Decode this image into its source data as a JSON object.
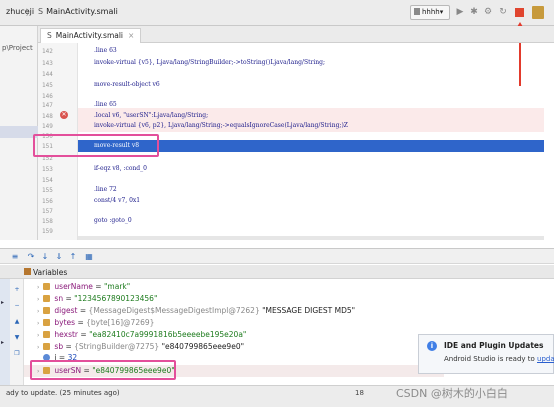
{
  "breadcrumb": {
    "project": "zhuceji",
    "separator": "〉",
    "file_prefix": "S",
    "file": "MainActivity.smali"
  },
  "toolbar": {
    "run_config": "hhhh",
    "run_config_arrow": "▾"
  },
  "project_panel": {
    "label": "p\\Project"
  },
  "editor": {
    "tab": {
      "prefix": "S",
      "label": "MainActivity.smali",
      "close": "×"
    },
    "lines": [
      {
        "num": "142",
        "code": ".line 63"
      },
      {
        "num": "143",
        "code": "invoke-virtual {v5}, Ljava/lang/StringBuilder;->toString()Ljava/lang/String;"
      },
      {
        "num": "144",
        "code": ""
      },
      {
        "num": "145",
        "code": "move-result-object v6"
      },
      {
        "num": "146",
        "code": ""
      },
      {
        "num": "147",
        "code": ".line 65"
      },
      {
        "num": "148",
        "code": ".local v6, \"userSN\":Ljava/lang/String;"
      },
      {
        "num": "149",
        "code": "invoke-virtual {v6, p2}, Ljava/lang/String;->equalsIgnoreCase(Ljava/lang/String;)Z"
      },
      {
        "num": "150",
        "code": ""
      },
      {
        "num": "151",
        "code": "move-result v8"
      },
      {
        "num": "152",
        "code": ""
      },
      {
        "num": "153",
        "code": "if-eqz v8, :cond_0"
      },
      {
        "num": "154",
        "code": ""
      },
      {
        "num": "155",
        "code": ".line 72"
      },
      {
        "num": "156",
        "code": "const/4 v7, 0x1"
      },
      {
        "num": "157",
        "code": ""
      },
      {
        "num": "158",
        "code": "goto :goto_0"
      },
      {
        "num": "159",
        "code": ""
      }
    ],
    "breakpoint_glyph": "✕"
  },
  "debug": {
    "panel_title": "Variables",
    "variables": [
      {
        "name": "userName",
        "value": "\"mark\"",
        "kind": "str"
      },
      {
        "name": "sn",
        "value": "\"1234567890123456\"",
        "kind": "str"
      },
      {
        "name": "digest",
        "type": "{MessageDigest$MessageDigestImpl@7262}",
        "value": "\"MESSAGE DIGEST MD5\"",
        "kind": "obj"
      },
      {
        "name": "bytes",
        "type": "{byte[16]@7269}",
        "value": "",
        "kind": "obj"
      },
      {
        "name": "hexstr",
        "value": "\"ea82410c7a9991816b5eeeebe195e20a\"",
        "kind": "str"
      },
      {
        "name": "sb",
        "type": "{StringBuilder@7275}",
        "value": "\"e840799865eee9e0\"",
        "kind": "obj"
      },
      {
        "name": "i",
        "value": "32",
        "kind": "num"
      },
      {
        "name": "userSN",
        "value": "\"e840799865eee9e0\"",
        "kind": "str"
      }
    ]
  },
  "popup": {
    "icon": "i",
    "title": "IDE and Plugin Updates",
    "body": "Android Studio is ready to ",
    "link": "upda"
  },
  "status": {
    "text": "ady to update. (25 minutes ago)",
    "position": "18",
    "watermark": "CSDN @树木的小白白"
  },
  "colors": {
    "stop": "#e0452f",
    "arrow": "#e23a2c",
    "highlight_box": "#e34f9b",
    "current_line": "#2f65ca"
  }
}
